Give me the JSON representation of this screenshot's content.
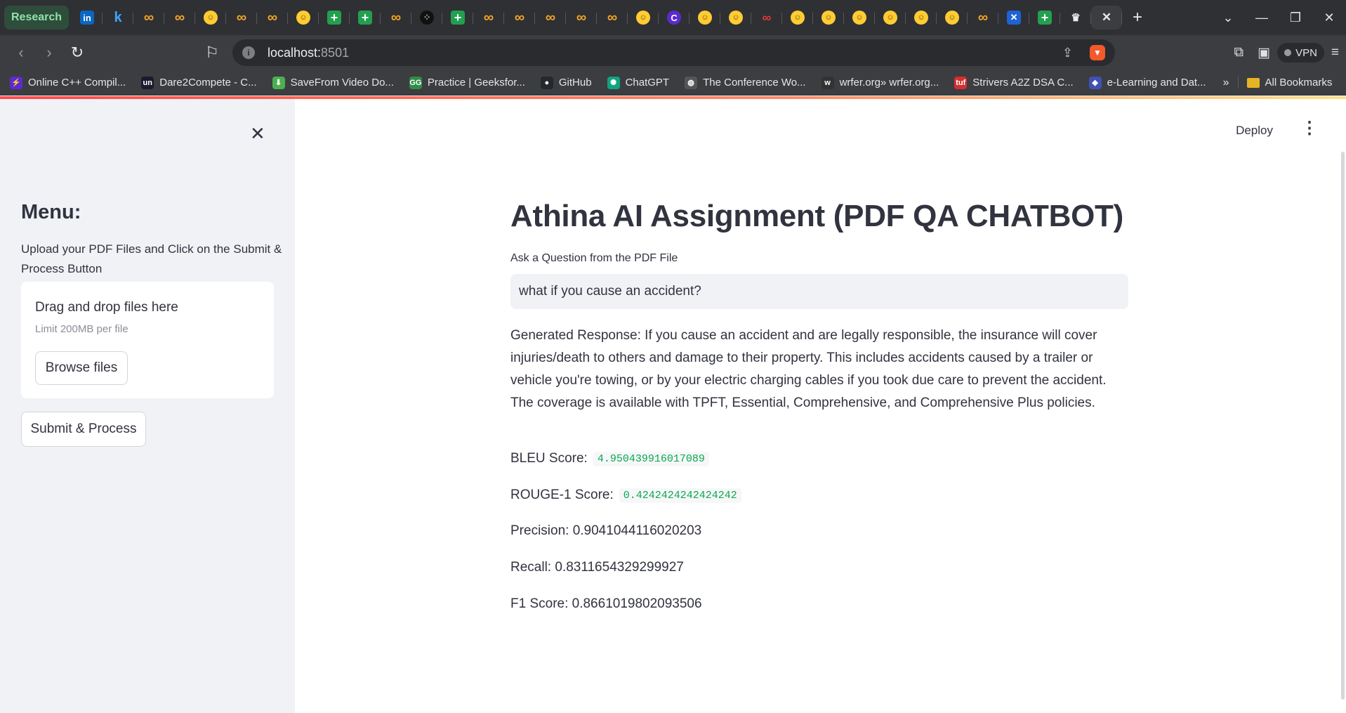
{
  "browser": {
    "tab_group_label": "Research",
    "tabs": [
      {
        "icon": "linkedin-icon",
        "glyph": "in",
        "style": "li"
      },
      {
        "icon": "k-icon",
        "glyph": "k",
        "style": "k"
      },
      {
        "icon": "infinity-icon",
        "glyph": "∞",
        "style": "inf"
      },
      {
        "icon": "infinity-icon",
        "glyph": "∞",
        "style": "inf"
      },
      {
        "icon": "huggingface-icon",
        "glyph": "☺",
        "style": "hug"
      },
      {
        "icon": "infinity-icon",
        "glyph": "∞",
        "style": "inf"
      },
      {
        "icon": "infinity-icon",
        "glyph": "∞",
        "style": "inf"
      },
      {
        "icon": "huggingface-icon",
        "glyph": "☺",
        "style": "hug"
      },
      {
        "icon": "sheets-plus-icon",
        "glyph": "+",
        "style": "plus"
      },
      {
        "icon": "sheets-plus-icon",
        "glyph": "+",
        "style": "plus"
      },
      {
        "icon": "infinity-icon",
        "glyph": "∞",
        "style": "inf"
      },
      {
        "icon": "dots-icon",
        "glyph": "⁘",
        "style": "dot"
      },
      {
        "icon": "sheets-plus-icon",
        "glyph": "+",
        "style": "plus"
      },
      {
        "icon": "infinity-icon",
        "glyph": "∞",
        "style": "inf"
      },
      {
        "icon": "infinity-icon",
        "glyph": "∞",
        "style": "inf"
      },
      {
        "icon": "infinity-icon",
        "glyph": "∞",
        "style": "inf"
      },
      {
        "icon": "infinity-icon",
        "glyph": "∞",
        "style": "inf"
      },
      {
        "icon": "infinity-icon",
        "glyph": "∞",
        "style": "inf"
      },
      {
        "icon": "huggingface-icon",
        "glyph": "☺",
        "style": "hug"
      },
      {
        "icon": "c-logo-icon",
        "glyph": "C",
        "style": "c"
      },
      {
        "icon": "huggingface-icon",
        "glyph": "☺",
        "style": "hug"
      },
      {
        "icon": "huggingface-icon",
        "glyph": "☺",
        "style": "hug"
      },
      {
        "icon": "red-infinity-icon",
        "glyph": "∞",
        "style": "red"
      },
      {
        "icon": "huggingface-icon",
        "glyph": "☺",
        "style": "hug"
      },
      {
        "icon": "huggingface-icon",
        "glyph": "☺",
        "style": "hug"
      },
      {
        "icon": "huggingface-icon",
        "glyph": "☺",
        "style": "hug"
      },
      {
        "icon": "huggingface-icon",
        "glyph": "☺",
        "style": "hug"
      },
      {
        "icon": "huggingface-icon",
        "glyph": "☺",
        "style": "hug"
      },
      {
        "icon": "huggingface-icon",
        "glyph": "☺",
        "style": "hug"
      },
      {
        "icon": "infinity-icon",
        "glyph": "∞",
        "style": "inf"
      },
      {
        "icon": "butterfly-icon",
        "glyph": "✕",
        "style": "blue"
      },
      {
        "icon": "sheets-plus-icon",
        "glyph": "+",
        "style": "plus"
      },
      {
        "icon": "crown-icon",
        "glyph": "♛",
        "style": "crown"
      },
      {
        "icon": "close-tab-icon",
        "glyph": "✕",
        "style": "active"
      }
    ],
    "url_host": "localhost:",
    "url_port": "8501",
    "vpn_label": "VPN",
    "bookmarks": [
      {
        "label": "Online C++ Compil...",
        "icon": "bolt-icon",
        "color": "#5b2bd1",
        "glyph": "⚡"
      },
      {
        "label": "Dare2Compete - C...",
        "icon": "unstop-icon",
        "color": "#1b1b2f",
        "glyph": "un"
      },
      {
        "label": "SaveFrom Video Do...",
        "icon": "download-arrow-icon",
        "color": "#4caf50",
        "glyph": "⬇"
      },
      {
        "label": "Practice | Geeksfor...",
        "icon": "gfg-icon",
        "color": "#2f8d46",
        "glyph": "GG"
      },
      {
        "label": "GitHub",
        "icon": "github-icon",
        "color": "#24292e",
        "glyph": "●"
      },
      {
        "label": "ChatGPT",
        "icon": "chatgpt-icon",
        "color": "#10a37f",
        "glyph": "✺"
      },
      {
        "label": "The Conference Wo...",
        "icon": "globe-icon",
        "color": "#555",
        "glyph": "◍"
      },
      {
        "label": "wrfer.org» wrfer.org...",
        "icon": "wrfer-icon",
        "color": "#333",
        "glyph": "w"
      },
      {
        "label": "Strivers A2Z DSA C...",
        "icon": "tuf-icon",
        "color": "#d32f2f",
        "glyph": "tuf"
      },
      {
        "label": "e-Learning and Dat...",
        "icon": "elearning-icon",
        "color": "#3f51b5",
        "glyph": "◆"
      }
    ],
    "more_bookmarks": "»",
    "all_bookmarks": "All Bookmarks"
  },
  "app": {
    "deploy_label": "Deploy",
    "sidebar": {
      "menu_title": "Menu:",
      "description": "Upload your PDF Files and Click on the Submit & Process Button",
      "dropzone_title": "Drag and drop files here",
      "dropzone_limit": "Limit 200MB per file",
      "browse_label": "Browse files",
      "submit_label": "Submit & Process"
    },
    "title": "Athina AI Assignment (PDF QA CHATBOT)",
    "question_label": "Ask a Question from the PDF File",
    "question_value": "what if you cause an accident?",
    "response": "Generated Response: If you cause an accident and are legally responsible, the insurance will cover injuries/death to others and damage to their property. This includes accidents caused by a trailer or vehicle you're towing, or by your electric charging cables if you took due care to prevent the accident. The coverage is available with TPFT, Essential, Comprehensive, and Comprehensive Plus policies.",
    "metrics": {
      "bleu_label": "BLEU Score:",
      "bleu_value": "4.950439916017089",
      "rouge_label": "ROUGE-1 Score:",
      "rouge_value": "0.4242424242424242",
      "precision": "Precision: 0.9041044116020203",
      "recall": "Recall: 0.8311654329299927",
      "f1": "F1 Score: 0.8661019802093506"
    }
  }
}
